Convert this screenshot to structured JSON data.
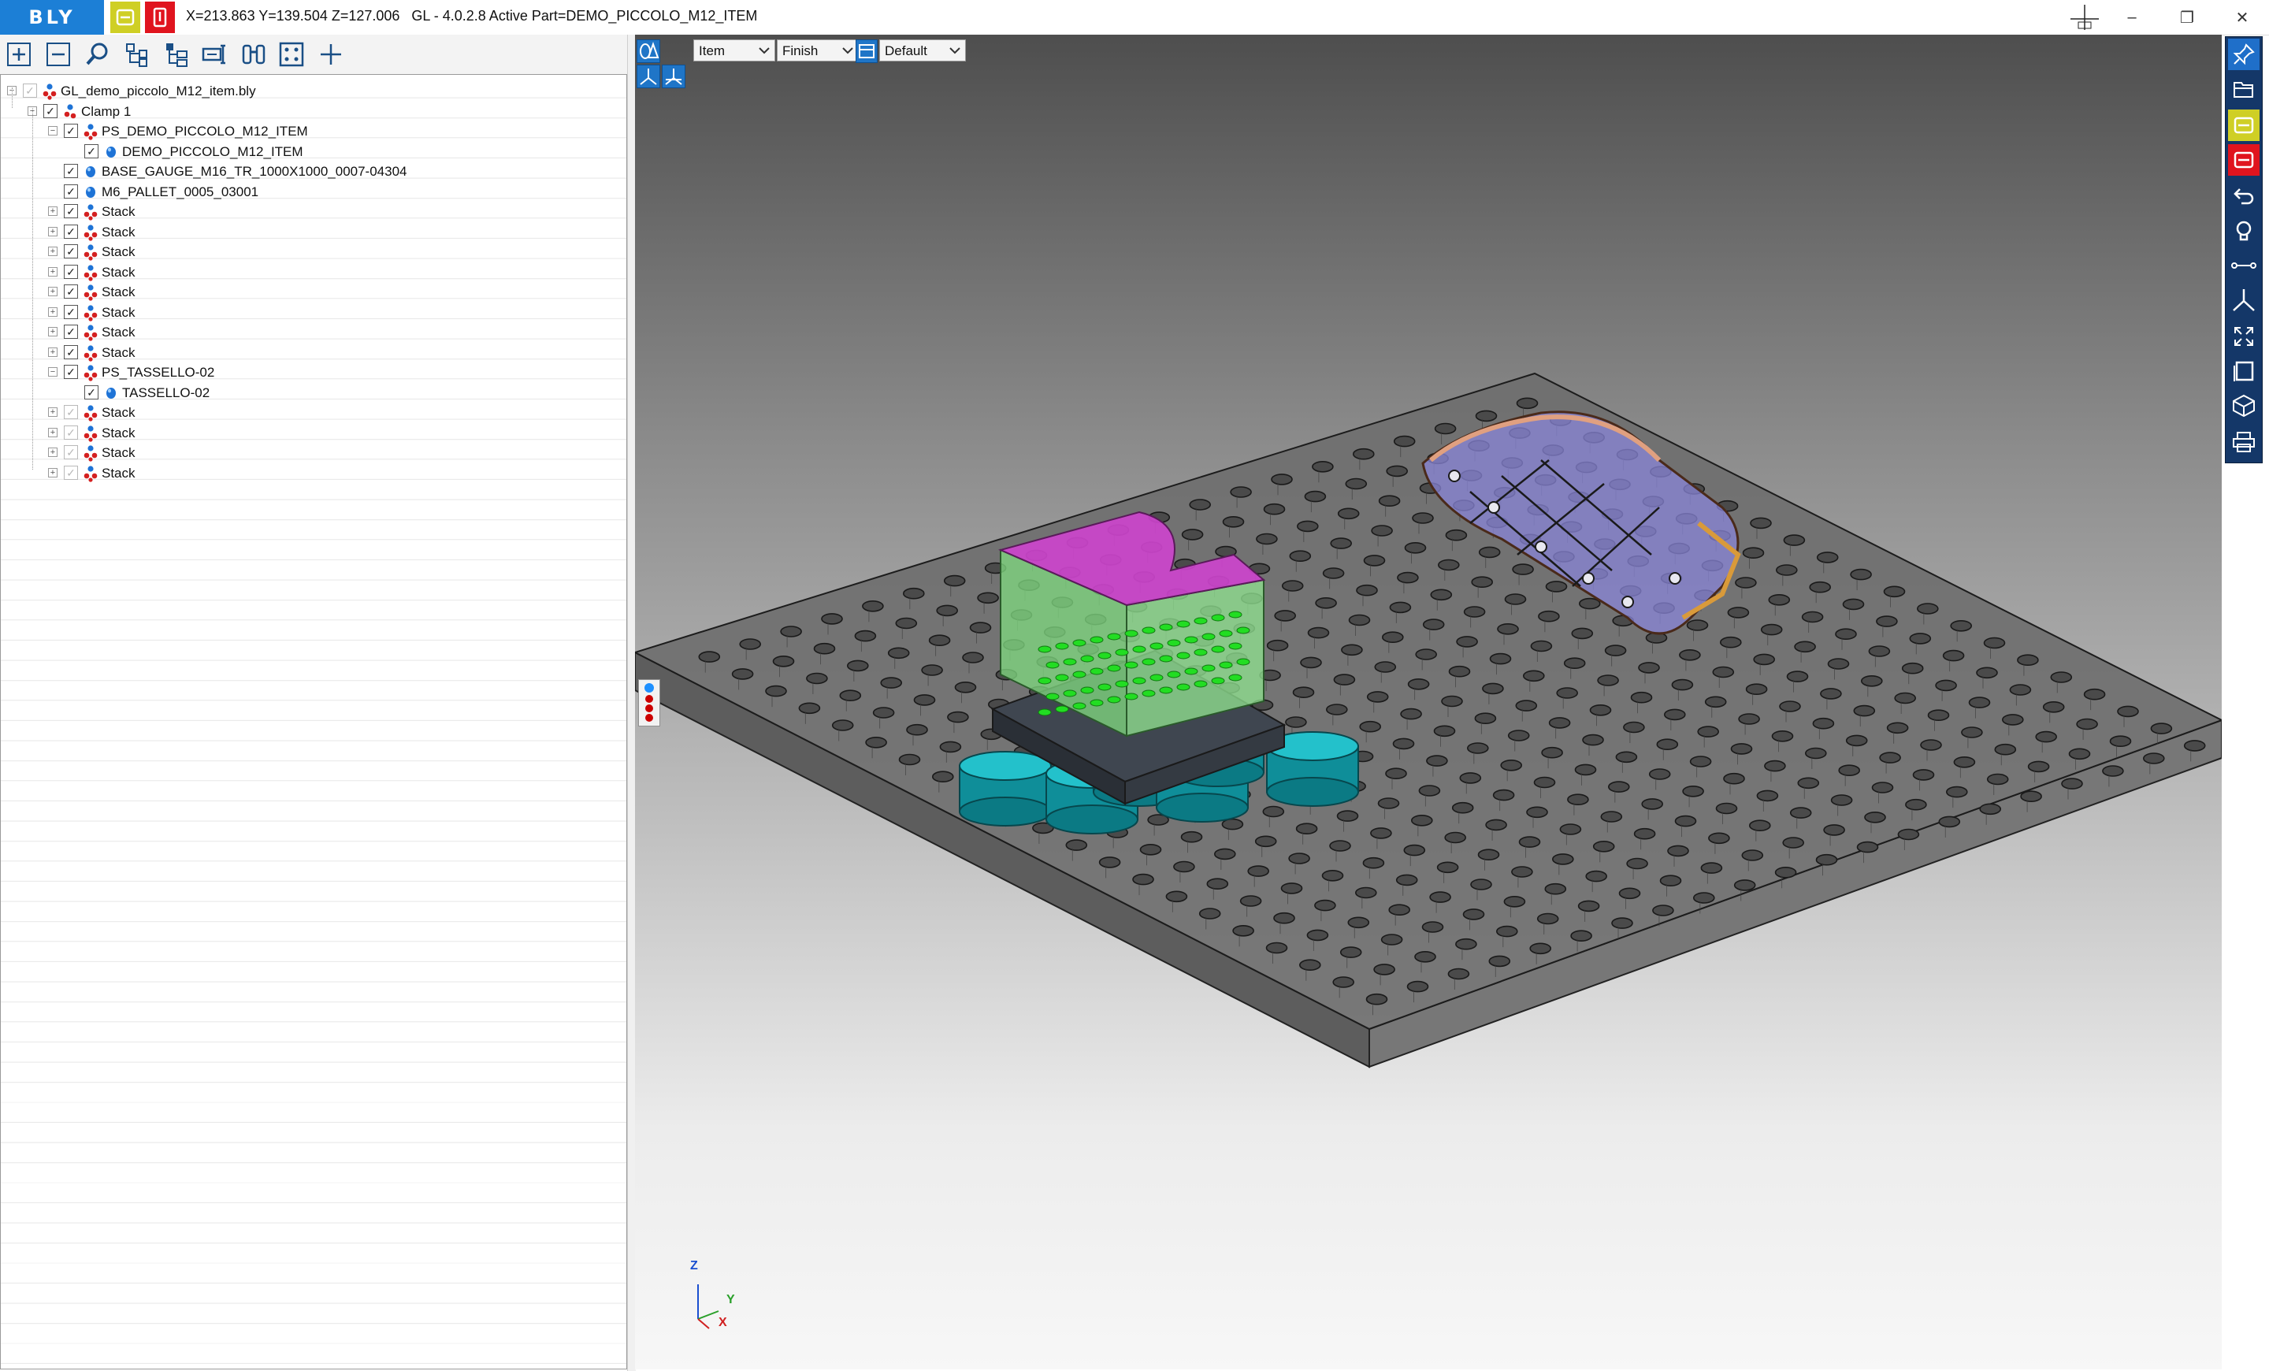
{
  "app": {
    "logo_text": "BLY",
    "status_text": "X=213.863 Y=139.504 Z=127.006   GL - 4.0.2.8 Active Part=DEMO_PICCOLO_M12_ITEM",
    "colors": {
      "brand_blue": "#1c7fd6",
      "yellow": "#cfcf25",
      "red": "#e0141e",
      "right_toolbar": "#143768"
    }
  },
  "window_controls": {
    "minimize": "–",
    "maximize": "❐",
    "close": "✕"
  },
  "tree_toolbar": {
    "icons": [
      "expand-all-icon",
      "collapse-all-icon",
      "search-icon",
      "hierarchy-icon",
      "tree-branch-icon",
      "move-tool-icon",
      "binoculars-icon",
      "fit-selection-icon",
      "add-icon"
    ]
  },
  "tree": {
    "items": [
      {
        "label": "GL_demo_piccolo_M12_item.bly",
        "level": 0,
        "expander": "−",
        "checked": true,
        "grey": true,
        "icon": "assembly"
      },
      {
        "label": "Clamp 1",
        "level": 1,
        "expander": "−",
        "checked": true,
        "grey": false,
        "icon": "clamp"
      },
      {
        "label": "PS_DEMO_PICCOLO_M12_ITEM",
        "level": 2,
        "expander": "−",
        "checked": true,
        "grey": false,
        "icon": "assembly"
      },
      {
        "label": "DEMO_PICCOLO_M12_ITEM",
        "level": 3,
        "expander": "",
        "checked": true,
        "grey": false,
        "icon": "part"
      },
      {
        "label": "BASE_GAUGE_M16_TR_1000X1000_0007-04304",
        "level": 2,
        "expander": "",
        "checked": true,
        "grey": false,
        "icon": "part"
      },
      {
        "label": "M6_PALLET_0005_03001",
        "level": 2,
        "expander": "",
        "checked": true,
        "grey": false,
        "icon": "part"
      },
      {
        "label": "Stack",
        "level": 2,
        "expander": "+",
        "checked": true,
        "grey": false,
        "icon": "assembly"
      },
      {
        "label": "Stack",
        "level": 2,
        "expander": "+",
        "checked": true,
        "grey": false,
        "icon": "assembly"
      },
      {
        "label": "Stack",
        "level": 2,
        "expander": "+",
        "checked": true,
        "grey": false,
        "icon": "assembly"
      },
      {
        "label": "Stack",
        "level": 2,
        "expander": "+",
        "checked": true,
        "grey": false,
        "icon": "assembly"
      },
      {
        "label": "Stack",
        "level": 2,
        "expander": "+",
        "checked": true,
        "grey": false,
        "icon": "assembly"
      },
      {
        "label": "Stack",
        "level": 2,
        "expander": "+",
        "checked": true,
        "grey": false,
        "icon": "assembly"
      },
      {
        "label": "Stack",
        "level": 2,
        "expander": "+",
        "checked": true,
        "grey": false,
        "icon": "assembly"
      },
      {
        "label": "Stack",
        "level": 2,
        "expander": "+",
        "checked": true,
        "grey": false,
        "icon": "assembly"
      },
      {
        "label": "PS_TASSELLO-02",
        "level": 2,
        "expander": "−",
        "checked": true,
        "grey": false,
        "icon": "assembly"
      },
      {
        "label": "TASSELLO-02",
        "level": 3,
        "expander": "",
        "checked": true,
        "grey": false,
        "icon": "part"
      },
      {
        "label": "Stack",
        "level": 2,
        "expander": "+",
        "checked": true,
        "grey": true,
        "icon": "assembly"
      },
      {
        "label": "Stack",
        "level": 2,
        "expander": "+",
        "checked": true,
        "grey": true,
        "icon": "assembly"
      },
      {
        "label": "Stack",
        "level": 2,
        "expander": "+",
        "checked": true,
        "grey": true,
        "icon": "assembly"
      },
      {
        "label": "Stack",
        "level": 2,
        "expander": "+",
        "checked": true,
        "grey": true,
        "icon": "assembly"
      }
    ]
  },
  "viewport_toolbar": {
    "select_filter": "Item",
    "render_mode": "Finish",
    "view_preset": "Default"
  },
  "axis_triad": {
    "z": "Z",
    "y": "Y",
    "x": "X"
  },
  "right_toolbar": {
    "icons": [
      "pin-icon",
      "open-folder-icon",
      "yellow-save-icon",
      "red-save-icon",
      "undo-icon",
      "light-bulb-icon",
      "measure-icon",
      "axis-icon",
      "fit-view-icon",
      "single-view-icon",
      "cube-view-icon",
      "print-icon"
    ]
  }
}
